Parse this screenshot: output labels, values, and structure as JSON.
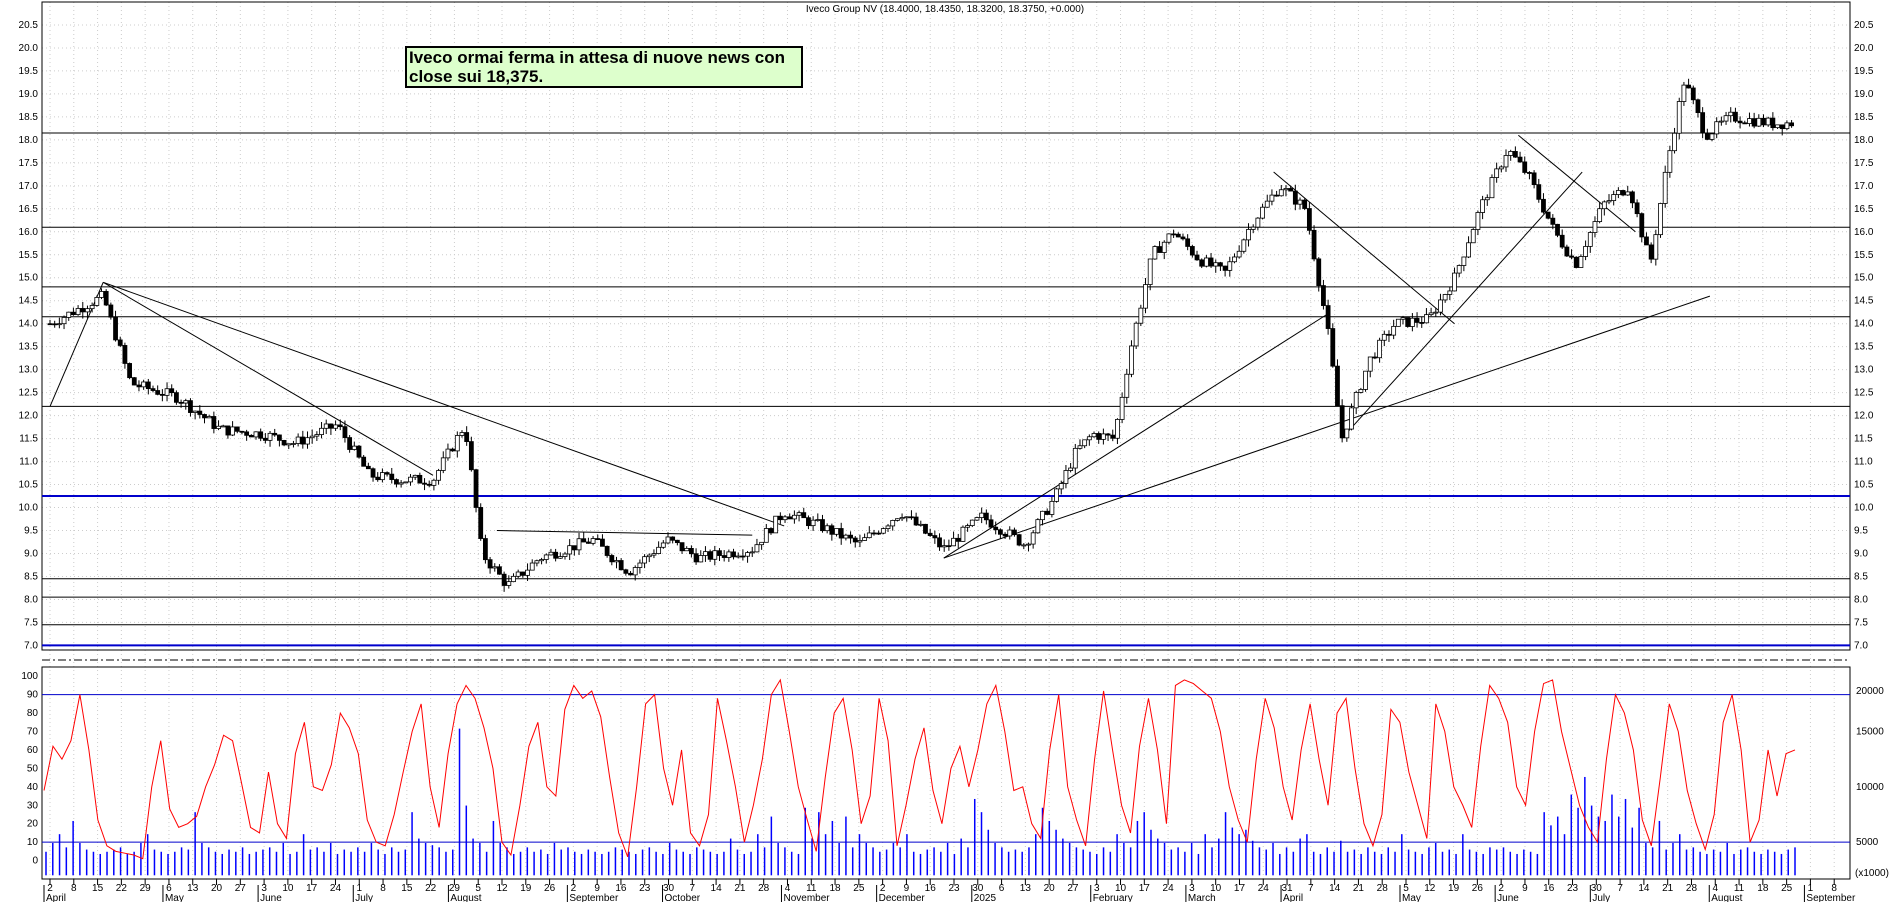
{
  "chart_data": [
    {
      "type": "candlestick",
      "title": "Iveco Group NV (18.4000, 18.4350, 18.3200, 18.3750, +0.000)",
      "annotation": "Iveco ormai ferma in attesa di nuove news con close sui 18,375.",
      "ylim": [
        6.9,
        21.0
      ],
      "y_ticks": [
        "7.0",
        "7.5",
        "8.0",
        "8.5",
        "9.0",
        "9.5",
        "10.0",
        "10.5",
        "11.0",
        "11.5",
        "12.0",
        "12.5",
        "13.0",
        "13.5",
        "14.0",
        "14.5",
        "15.0",
        "15.5",
        "16.0",
        "16.5",
        "17.0",
        "17.5",
        "18.0",
        "18.5",
        "19.0",
        "19.5",
        "20.0",
        "20.5"
      ],
      "grid": true,
      "horizontal_levels": [
        7.0,
        7.45,
        8.05,
        8.45,
        10.25,
        12.2,
        14.15,
        14.8,
        16.1,
        18.15
      ],
      "blue_levels": [
        7.0,
        10.25
      ],
      "price_path": [
        [
          0,
          14.0
        ],
        [
          25,
          14.6
        ],
        [
          38,
          12.7
        ],
        [
          60,
          12.4
        ],
        [
          80,
          11.7
        ],
        [
          100,
          11.6
        ],
        [
          115,
          11.4
        ],
        [
          135,
          11.8
        ],
        [
          150,
          10.7
        ],
        [
          165,
          10.6
        ],
        [
          180,
          10.6
        ],
        [
          195,
          11.8
        ],
        [
          203,
          9.0
        ],
        [
          215,
          8.3
        ],
        [
          230,
          8.9
        ],
        [
          255,
          9.3
        ],
        [
          272,
          8.6
        ],
        [
          290,
          9.3
        ],
        [
          305,
          8.9
        ],
        [
          330,
          9.1
        ],
        [
          345,
          9.9
        ],
        [
          362,
          9.6
        ],
        [
          380,
          9.2
        ],
        [
          400,
          9.9
        ],
        [
          420,
          9.1
        ],
        [
          438,
          9.8
        ],
        [
          458,
          9.2
        ],
        [
          472,
          10.2
        ],
        [
          482,
          11.2
        ],
        [
          490,
          11.6
        ],
        [
          500,
          11.5
        ],
        [
          508,
          13.5
        ],
        [
          518,
          15.5
        ],
        [
          528,
          16.0
        ],
        [
          540,
          15.4
        ],
        [
          552,
          15.1
        ],
        [
          565,
          16.2
        ],
        [
          578,
          17.0
        ],
        [
          590,
          16.5
        ],
        [
          600,
          14.0
        ],
        [
          607,
          11.5
        ],
        [
          620,
          13.2
        ],
        [
          632,
          14.0
        ],
        [
          648,
          14.1
        ],
        [
          660,
          15.0
        ],
        [
          672,
          16.5
        ],
        [
          685,
          17.8
        ],
        [
          695,
          17.2
        ],
        [
          707,
          16.0
        ],
        [
          717,
          15.3
        ],
        [
          730,
          16.6
        ],
        [
          742,
          17.0
        ],
        [
          752,
          15.3
        ],
        [
          760,
          17.5
        ],
        [
          768,
          19.3
        ],
        [
          778,
          18.1
        ],
        [
          790,
          18.5
        ],
        [
          810,
          18.35
        ],
        [
          820,
          18.375
        ]
      ]
    },
    {
      "type": "line",
      "series_name": "oscillator",
      "ylim": [
        -10,
        105
      ],
      "y_ticks": [
        "0",
        "10",
        "20",
        "30",
        "40",
        "50",
        "60",
        "70",
        "80",
        "90",
        "100"
      ],
      "levels": [
        10,
        90
      ],
      "values": [
        38,
        62,
        55,
        65,
        90,
        60,
        22,
        8,
        5,
        4,
        3,
        1,
        40,
        65,
        28,
        18,
        20,
        24,
        40,
        52,
        68,
        65,
        42,
        18,
        15,
        48,
        20,
        12,
        58,
        75,
        40,
        38,
        52,
        80,
        72,
        58,
        22,
        10,
        8,
        25,
        48,
        70,
        85,
        40,
        18,
        58,
        85,
        95,
        88,
        72,
        50,
        10,
        3,
        30,
        62,
        75,
        40,
        35,
        82,
        95,
        88,
        92,
        78,
        45,
        15,
        2,
        40,
        85,
        90,
        50,
        30,
        60,
        15,
        8,
        25,
        88,
        65,
        40,
        10,
        30,
        55,
        90,
        98,
        70,
        40,
        22,
        5,
        45,
        80,
        88,
        60,
        20,
        35,
        88,
        65,
        8,
        30,
        55,
        72,
        38,
        20,
        50,
        62,
        40,
        60,
        85,
        95,
        70,
        38,
        40,
        20,
        12,
        60,
        90,
        40,
        22,
        8,
        55,
        92,
        60,
        30,
        15,
        62,
        88,
        60,
        20,
        95,
        98,
        96,
        92,
        88,
        70,
        40,
        22,
        10,
        55,
        88,
        72,
        40,
        22,
        60,
        85,
        55,
        30,
        80,
        88,
        50,
        20,
        8,
        25,
        82,
        75,
        48,
        30,
        12,
        85,
        70,
        40,
        30,
        18,
        62,
        95,
        88,
        75,
        40,
        30,
        70,
        96,
        98,
        70,
        50,
        30,
        18,
        10,
        55,
        90,
        80,
        60,
        22,
        8,
        45,
        85,
        70,
        38,
        20,
        6,
        25,
        75,
        90,
        60,
        10,
        22,
        60,
        35,
        58,
        60
      ],
      "right_ticks": [
        "5000",
        "10000",
        "15000",
        "20000"
      ],
      "right_unit": "(x1000)"
    },
    {
      "type": "bar",
      "series_name": "volume",
      "values": [
        4,
        8,
        12,
        6,
        18,
        8,
        5,
        4,
        3,
        4,
        5,
        6,
        3,
        4,
        8,
        12,
        5,
        4,
        3,
        4,
        6,
        5,
        22,
        8,
        6,
        4,
        3,
        5,
        4,
        6,
        3,
        4,
        5,
        6,
        4,
        8,
        3,
        4,
        12,
        5,
        6,
        4,
        8,
        3,
        5,
        4,
        6,
        4,
        8,
        5,
        3,
        6,
        4,
        5,
        22,
        10,
        8,
        7,
        6,
        4,
        5,
        60,
        25,
        10,
        8,
        4,
        18,
        8,
        6,
        3,
        4,
        6,
        4,
        5,
        3,
        8,
        5,
        6,
        4,
        3,
        5,
        4,
        3,
        4,
        6,
        5,
        4,
        3,
        5,
        6,
        4,
        3,
        8,
        5,
        4,
        3,
        6,
        5,
        4,
        3,
        4,
        10,
        5,
        3,
        4,
        12,
        6,
        20,
        8,
        6,
        4,
        3,
        24,
        10,
        22,
        12,
        18,
        8,
        20,
        6,
        12,
        8,
        6,
        4,
        5,
        8,
        6,
        12,
        4,
        3,
        5,
        6,
        4,
        8,
        3,
        10,
        6,
        28,
        22,
        14,
        8,
        6,
        4,
        5,
        4,
        6,
        12,
        24,
        18,
        14,
        10,
        8,
        6,
        5,
        4,
        3,
        6,
        4,
        12,
        8,
        6,
        18,
        22,
        14,
        10,
        8,
        5,
        6,
        4,
        8,
        3,
        12,
        6,
        10,
        22,
        15,
        12,
        14,
        9,
        6,
        5,
        8,
        3,
        6,
        4,
        10,
        12,
        4,
        3,
        6,
        4,
        9,
        4,
        5,
        3,
        6,
        4,
        3,
        6,
        4,
        12,
        5,
        4,
        3,
        6,
        8,
        4,
        5,
        3,
        12,
        5,
        4,
        3,
        6,
        5,
        6,
        4,
        3,
        5,
        4,
        3,
        22,
        16,
        20,
        12,
        30,
        24,
        38,
        25,
        20,
        18,
        30,
        20,
        28,
        15,
        24,
        8,
        6,
        18,
        5,
        8,
        12,
        5,
        6,
        4,
        3,
        5,
        4,
        8,
        3,
        5,
        6,
        4,
        3,
        5,
        4,
        3,
        5,
        6
      ]
    }
  ],
  "x_axis": {
    "day_labels": [
      "2",
      "8",
      "15",
      "22",
      "29",
      "6",
      "13",
      "20",
      "27",
      "3",
      "10",
      "17",
      "24",
      "1",
      "8",
      "15",
      "22",
      "29",
      "5",
      "12",
      "19",
      "26",
      "2",
      "9",
      "16",
      "23",
      "30",
      "7",
      "14",
      "21",
      "28",
      "4",
      "11",
      "18",
      "25",
      "2",
      "9",
      "16",
      "23",
      "30",
      "6",
      "13",
      "20",
      "27",
      "3",
      "10",
      "17",
      "24",
      "3",
      "10",
      "17",
      "24",
      "31",
      "7",
      "14",
      "21",
      "28",
      "5",
      "12",
      "19",
      "26",
      "2",
      "9",
      "16",
      "23",
      "30",
      "7",
      "14",
      "21",
      "28",
      "4",
      "11",
      "18",
      "25",
      "1",
      "8"
    ],
    "month_labels": [
      "April",
      "May",
      "June",
      "July",
      "August",
      "September",
      "October",
      "November",
      "December",
      "2025",
      "February",
      "March",
      "April",
      "May",
      "June",
      "July",
      "August",
      "September"
    ]
  }
}
